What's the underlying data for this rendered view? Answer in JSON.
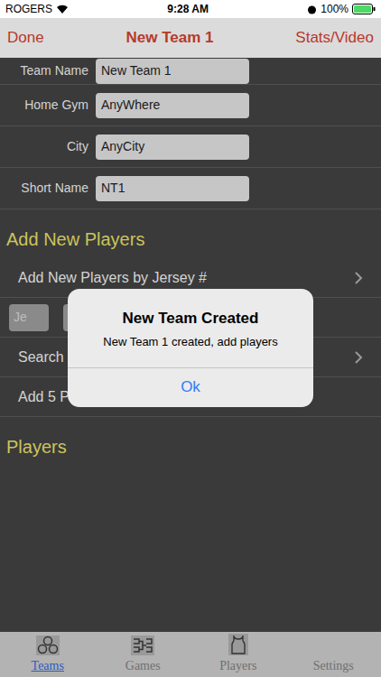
{
  "status_bar": {
    "carrier": "ROGERS",
    "time": "9:28 AM",
    "battery": "100%"
  },
  "nav_bar": {
    "left": "Done",
    "title": "New Team 1",
    "right": "Stats/Video"
  },
  "fields": [
    {
      "label": "Team Name",
      "value": "New Team 1"
    },
    {
      "label": "Home Gym",
      "value": "AnyWhere"
    },
    {
      "label": "City",
      "value": "AnyCity"
    },
    {
      "label": "Short Name",
      "value": "NT1"
    }
  ],
  "sections": [
    {
      "title": "Add New Players",
      "rows": [
        {
          "kind": "link",
          "label": "Add New Players by Jersey #"
        },
        {
          "kind": "inputs",
          "label": "Je"
        },
        {
          "kind": "link",
          "label": "Search"
        },
        {
          "kind": "plain",
          "label": "Add 5 Players"
        }
      ]
    },
    {
      "title": "Players",
      "rows": []
    }
  ],
  "alert": {
    "title": "New Team Created",
    "message": "New Team 1 created, add players",
    "button": "Ok"
  },
  "tabs": [
    {
      "label": "Teams",
      "selected": true
    },
    {
      "label": "Games",
      "selected": false
    },
    {
      "label": "Players",
      "selected": false
    },
    {
      "label": "Settings",
      "selected": false
    }
  ]
}
